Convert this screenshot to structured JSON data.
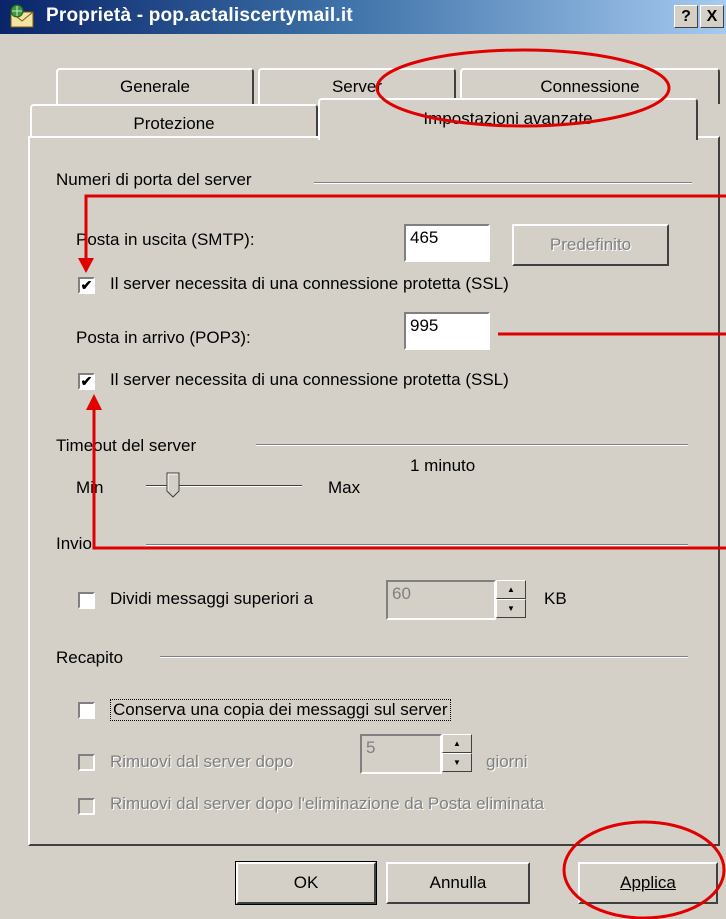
{
  "window": {
    "title": "Proprietà - pop.actaliscertymail.it",
    "help_btn": "?",
    "close_btn": "X"
  },
  "tabs": {
    "row1": [
      "Generale",
      "Server",
      "Connessione"
    ],
    "row2": [
      "Protezione",
      "Impostazioni avanzate"
    ],
    "active": "Impostazioni avanzate"
  },
  "ports": {
    "group_label": "Numeri di porta del server",
    "smtp_label": "Posta in uscita (SMTP):",
    "smtp_value": "465",
    "default_btn": "Predefinito",
    "smtp_ssl_label": "Il server necessita di una connessione protetta (SSL)",
    "smtp_ssl_checked": true,
    "pop3_label": "Posta in arrivo (POP3):",
    "pop3_value": "995",
    "pop3_ssl_label": "Il server necessita di una connessione protetta (SSL)",
    "pop3_ssl_checked": true
  },
  "timeout": {
    "group_label": "Timeout del server",
    "min_label": "Min",
    "max_label": "Max",
    "value_text": "1 minuto",
    "slider_level": 0.2
  },
  "send": {
    "group_label": "Invio",
    "split_label": "Dividi messaggi superiori a",
    "split_checked": false,
    "split_value": "60",
    "unit": "KB"
  },
  "delivery": {
    "group_label": "Recapito",
    "keep_copy_label": "Conserva una copia dei messaggi sul server",
    "keep_copy_checked": false,
    "remove_after_label": "Rimuovi dal server dopo",
    "remove_after_value": "5",
    "days_unit": "giorni",
    "remove_deleted_label": "Rimuovi dal server dopo l'eliminazione da Posta eliminata"
  },
  "buttons": {
    "ok": "OK",
    "cancel": "Annulla",
    "apply": "Applica"
  },
  "colors": {
    "annotation": "#e00000",
    "title_bar": "#0a246a",
    "dialog_face": "#d4d0c8"
  }
}
